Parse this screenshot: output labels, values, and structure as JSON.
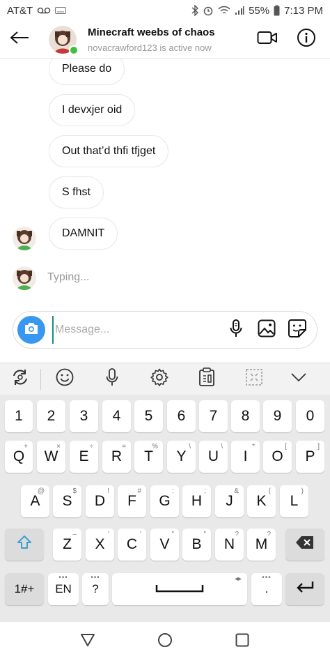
{
  "status_bar": {
    "carrier": "AT&T",
    "battery": "55%",
    "time": "7:13 PM"
  },
  "header": {
    "title": "Minecraft weebs of chaos",
    "subtitle": "novacrawford123 is active now"
  },
  "messages": [
    {
      "text": "Please do"
    },
    {
      "text": "I devxjer oid"
    },
    {
      "text": "Out that’d thfi tfjget"
    },
    {
      "text": "S fhst"
    },
    {
      "text": "DAMNIT"
    }
  ],
  "typing_label": "Typing...",
  "composer": {
    "placeholder": "Message..."
  },
  "keyboard": {
    "number_row": [
      "1",
      "2",
      "3",
      "4",
      "5",
      "6",
      "7",
      "8",
      "9",
      "0"
    ],
    "row1": [
      {
        "k": "Q",
        "s": "+"
      },
      {
        "k": "W",
        "s": "×"
      },
      {
        "k": "E",
        "s": "÷"
      },
      {
        "k": "R",
        "s": "="
      },
      {
        "k": "T",
        "s": "%"
      },
      {
        "k": "Y",
        "s": "\\"
      },
      {
        "k": "U",
        "s": "\\"
      },
      {
        "k": "I",
        "s": "*"
      },
      {
        "k": "O",
        "s": "["
      },
      {
        "k": "P",
        "s": "]"
      }
    ],
    "row2": [
      {
        "k": "A",
        "s": "@"
      },
      {
        "k": "S",
        "s": "$"
      },
      {
        "k": "D",
        "s": "!"
      },
      {
        "k": "F",
        "s": "#"
      },
      {
        "k": "G",
        "s": ":"
      },
      {
        "k": "H",
        "s": ";"
      },
      {
        "k": "J",
        "s": "&"
      },
      {
        "k": "K",
        "s": "("
      },
      {
        "k": "L",
        "s": ")"
      }
    ],
    "row3": [
      {
        "k": "Z",
        "s": "–"
      },
      {
        "k": "X",
        "s": "'"
      },
      {
        "k": "C",
        "s": "’"
      },
      {
        "k": "V",
        "s": "\""
      },
      {
        "k": "B",
        "s": "\""
      },
      {
        "k": "N",
        "s": "?"
      },
      {
        "k": "M",
        "s": "?"
      }
    ],
    "symbols_key": "1#+",
    "lang_key": "EN",
    "question_key": "?",
    "period_key": "."
  },
  "colors": {
    "accent": "#3897f0",
    "online": "#3cc23c",
    "keyboard_bg": "#e9e9e9",
    "shift_icon": "#3aa0d0"
  }
}
